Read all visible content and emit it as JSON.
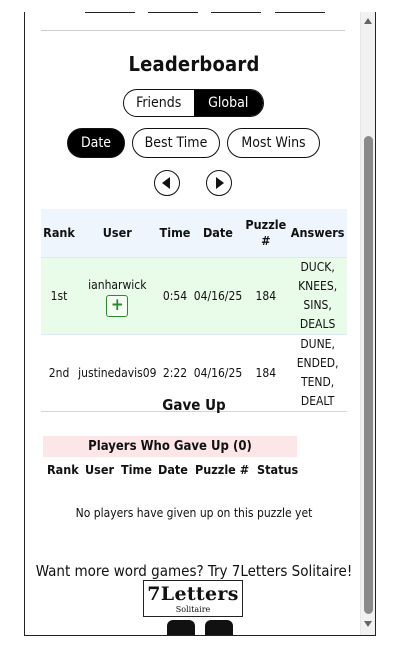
{
  "leaderboard": {
    "title": "Leaderboard",
    "scope_tabs": [
      "Friends",
      "Global"
    ],
    "active_scope": "Global",
    "sort_tabs": [
      "Date",
      "Best Time",
      "Most Wins"
    ],
    "active_sort": "Date",
    "columns": [
      "Rank",
      "User",
      "Time",
      "Date",
      "Puzzle #",
      "Answers"
    ],
    "rows": [
      {
        "rank": "1st",
        "user": "ianharwick",
        "time": "0:54",
        "date": "04/16/25",
        "puzzle": "184",
        "answers": "DUCK, KNEES, SINS, DEALS",
        "add_label": "+"
      },
      {
        "rank": "2nd",
        "user": "justinedavis09",
        "time": "2:22",
        "date": "04/16/25",
        "puzzle": "184",
        "answers": "DUNE, ENDED, TEND, DEALT"
      }
    ]
  },
  "gave_up": {
    "title": "Gave Up",
    "section_label": "Players Who Gave Up (0)",
    "columns": [
      "Rank",
      "User",
      "Time",
      "Date",
      "Puzzle #",
      "Status"
    ],
    "empty_message": "No players have given up on this puzzle yet"
  },
  "promo": {
    "text": "Want more word games? Try 7Letters Solitaire!",
    "logo_title": "7Letters",
    "logo_subtitle": "Solitaire"
  },
  "icons": {
    "prev": "chevron-left-icon",
    "next": "chevron-right-icon",
    "social1": "facebook-icon",
    "social2": "instagram-icon"
  }
}
